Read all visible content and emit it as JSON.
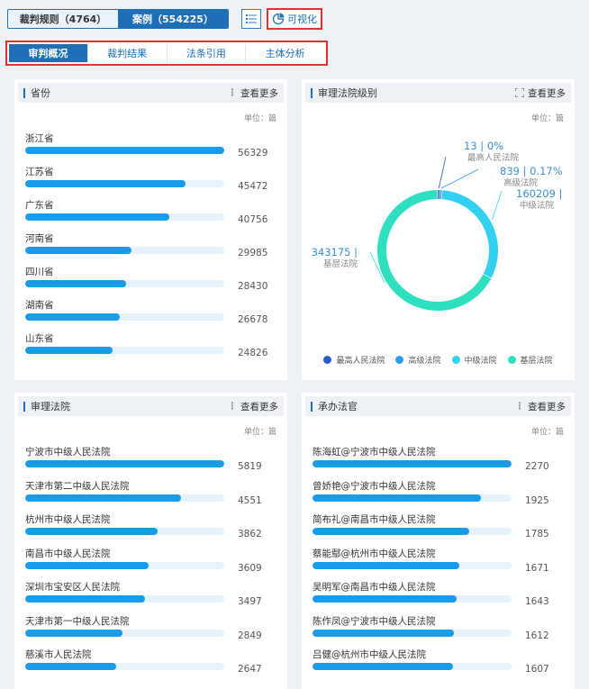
{
  "top_toggle": {
    "left": "裁判规则（4764）",
    "right": "案例（554225）"
  },
  "visualize_label": "可视化",
  "tabs": [
    "审判概况",
    "裁判结果",
    "法条引用",
    "主体分析"
  ],
  "common": {
    "more": "查看更多",
    "unit": "单位：篇"
  },
  "province": {
    "title": "省份",
    "max": 56329,
    "items": [
      {
        "label": "浙江省",
        "value": "56329",
        "num": 56329
      },
      {
        "label": "江苏省",
        "value": "45472",
        "num": 45472
      },
      {
        "label": "广东省",
        "value": "40756",
        "num": 40756
      },
      {
        "label": "河南省",
        "value": "29985",
        "num": 29985
      },
      {
        "label": "四川省",
        "value": "28430",
        "num": 28430
      },
      {
        "label": "湖南省",
        "value": "26678",
        "num": 26678
      },
      {
        "label": "山东省",
        "value": "24826",
        "num": 24826
      }
    ]
  },
  "court_level": {
    "title": "审理法院级别",
    "chart_data": {
      "type": "pie",
      "categories": [
        "最高人民法院",
        "高级法院",
        "中级法院",
        "基层法院"
      ],
      "values": [
        13,
        839,
        160209,
        343175
      ],
      "colors": [
        "#2c5cc5",
        "#2d9be6",
        "#33d0f0",
        "#2fe0c0"
      ],
      "labels": [
        {
          "num": "13 | 0%",
          "name": "最高人民法院"
        },
        {
          "num": "839 | 0.17%",
          "name": "高级法院"
        },
        {
          "num": "160209 |",
          "name": "中级法院"
        },
        {
          "num": "343175 |",
          "name": "基层法院"
        }
      ]
    }
  },
  "court": {
    "title": "审理法院",
    "max": 5819,
    "items": [
      {
        "label": "宁波市中级人民法院",
        "value": "5819",
        "num": 5819
      },
      {
        "label": "天津市第二中级人民法院",
        "value": "4551",
        "num": 4551
      },
      {
        "label": "杭州市中级人民法院",
        "value": "3862",
        "num": 3862
      },
      {
        "label": "南昌市中级人民法院",
        "value": "3609",
        "num": 3609
      },
      {
        "label": "深圳市宝安区人民法院",
        "value": "3497",
        "num": 3497
      },
      {
        "label": "天津市第一中级人民法院",
        "value": "2849",
        "num": 2849
      },
      {
        "label": "慈溪市人民法院",
        "value": "2647",
        "num": 2647
      }
    ]
  },
  "judge": {
    "title": "承办法官",
    "max": 2270,
    "items": [
      {
        "label": "陈海虹@宁波市中级人民法院",
        "value": "2270",
        "num": 2270
      },
      {
        "label": "曾娇艳@宁波市中级人民法院",
        "value": "1925",
        "num": 1925
      },
      {
        "label": "简布礼@南昌市中级人民法院",
        "value": "1785",
        "num": 1785
      },
      {
        "label": "蔡能鄢@杭州市中级人民法院",
        "value": "1671",
        "num": 1671
      },
      {
        "label": "吴明军@南昌市中级人民法院",
        "value": "1643",
        "num": 1643
      },
      {
        "label": "陈作凤@宁波市中级人民法院",
        "value": "1612",
        "num": 1612
      },
      {
        "label": "吕健@杭州市中级人民法院",
        "value": "1607",
        "num": 1607
      }
    ]
  },
  "icons": {
    "list": "list-icon",
    "pie": "pie-chart-icon",
    "expand": "expand-icon",
    "more": "more-dots-icon"
  }
}
